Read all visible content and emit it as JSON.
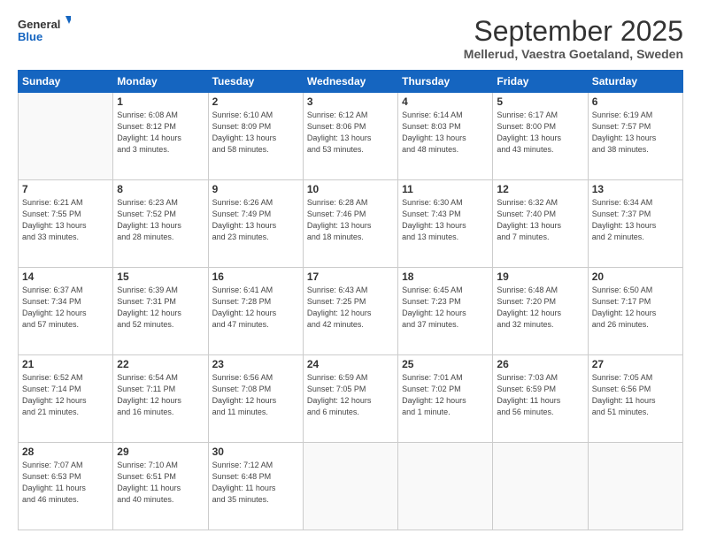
{
  "logo": {
    "general": "General",
    "blue": "Blue"
  },
  "header": {
    "month": "September 2025",
    "location": "Mellerud, Vaestra Goetaland, Sweden"
  },
  "weekdays": [
    "Sunday",
    "Monday",
    "Tuesday",
    "Wednesday",
    "Thursday",
    "Friday",
    "Saturday"
  ],
  "weeks": [
    [
      {
        "day": "",
        "info": ""
      },
      {
        "day": "1",
        "info": "Sunrise: 6:08 AM\nSunset: 8:12 PM\nDaylight: 14 hours\nand 3 minutes."
      },
      {
        "day": "2",
        "info": "Sunrise: 6:10 AM\nSunset: 8:09 PM\nDaylight: 13 hours\nand 58 minutes."
      },
      {
        "day": "3",
        "info": "Sunrise: 6:12 AM\nSunset: 8:06 PM\nDaylight: 13 hours\nand 53 minutes."
      },
      {
        "day": "4",
        "info": "Sunrise: 6:14 AM\nSunset: 8:03 PM\nDaylight: 13 hours\nand 48 minutes."
      },
      {
        "day": "5",
        "info": "Sunrise: 6:17 AM\nSunset: 8:00 PM\nDaylight: 13 hours\nand 43 minutes."
      },
      {
        "day": "6",
        "info": "Sunrise: 6:19 AM\nSunset: 7:57 PM\nDaylight: 13 hours\nand 38 minutes."
      }
    ],
    [
      {
        "day": "7",
        "info": "Sunrise: 6:21 AM\nSunset: 7:55 PM\nDaylight: 13 hours\nand 33 minutes."
      },
      {
        "day": "8",
        "info": "Sunrise: 6:23 AM\nSunset: 7:52 PM\nDaylight: 13 hours\nand 28 minutes."
      },
      {
        "day": "9",
        "info": "Sunrise: 6:26 AM\nSunset: 7:49 PM\nDaylight: 13 hours\nand 23 minutes."
      },
      {
        "day": "10",
        "info": "Sunrise: 6:28 AM\nSunset: 7:46 PM\nDaylight: 13 hours\nand 18 minutes."
      },
      {
        "day": "11",
        "info": "Sunrise: 6:30 AM\nSunset: 7:43 PM\nDaylight: 13 hours\nand 13 minutes."
      },
      {
        "day": "12",
        "info": "Sunrise: 6:32 AM\nSunset: 7:40 PM\nDaylight: 13 hours\nand 7 minutes."
      },
      {
        "day": "13",
        "info": "Sunrise: 6:34 AM\nSunset: 7:37 PM\nDaylight: 13 hours\nand 2 minutes."
      }
    ],
    [
      {
        "day": "14",
        "info": "Sunrise: 6:37 AM\nSunset: 7:34 PM\nDaylight: 12 hours\nand 57 minutes."
      },
      {
        "day": "15",
        "info": "Sunrise: 6:39 AM\nSunset: 7:31 PM\nDaylight: 12 hours\nand 52 minutes."
      },
      {
        "day": "16",
        "info": "Sunrise: 6:41 AM\nSunset: 7:28 PM\nDaylight: 12 hours\nand 47 minutes."
      },
      {
        "day": "17",
        "info": "Sunrise: 6:43 AM\nSunset: 7:25 PM\nDaylight: 12 hours\nand 42 minutes."
      },
      {
        "day": "18",
        "info": "Sunrise: 6:45 AM\nSunset: 7:23 PM\nDaylight: 12 hours\nand 37 minutes."
      },
      {
        "day": "19",
        "info": "Sunrise: 6:48 AM\nSunset: 7:20 PM\nDaylight: 12 hours\nand 32 minutes."
      },
      {
        "day": "20",
        "info": "Sunrise: 6:50 AM\nSunset: 7:17 PM\nDaylight: 12 hours\nand 26 minutes."
      }
    ],
    [
      {
        "day": "21",
        "info": "Sunrise: 6:52 AM\nSunset: 7:14 PM\nDaylight: 12 hours\nand 21 minutes."
      },
      {
        "day": "22",
        "info": "Sunrise: 6:54 AM\nSunset: 7:11 PM\nDaylight: 12 hours\nand 16 minutes."
      },
      {
        "day": "23",
        "info": "Sunrise: 6:56 AM\nSunset: 7:08 PM\nDaylight: 12 hours\nand 11 minutes."
      },
      {
        "day": "24",
        "info": "Sunrise: 6:59 AM\nSunset: 7:05 PM\nDaylight: 12 hours\nand 6 minutes."
      },
      {
        "day": "25",
        "info": "Sunrise: 7:01 AM\nSunset: 7:02 PM\nDaylight: 12 hours\nand 1 minute."
      },
      {
        "day": "26",
        "info": "Sunrise: 7:03 AM\nSunset: 6:59 PM\nDaylight: 11 hours\nand 56 minutes."
      },
      {
        "day": "27",
        "info": "Sunrise: 7:05 AM\nSunset: 6:56 PM\nDaylight: 11 hours\nand 51 minutes."
      }
    ],
    [
      {
        "day": "28",
        "info": "Sunrise: 7:07 AM\nSunset: 6:53 PM\nDaylight: 11 hours\nand 46 minutes."
      },
      {
        "day": "29",
        "info": "Sunrise: 7:10 AM\nSunset: 6:51 PM\nDaylight: 11 hours\nand 40 minutes."
      },
      {
        "day": "30",
        "info": "Sunrise: 7:12 AM\nSunset: 6:48 PM\nDaylight: 11 hours\nand 35 minutes."
      },
      {
        "day": "",
        "info": ""
      },
      {
        "day": "",
        "info": ""
      },
      {
        "day": "",
        "info": ""
      },
      {
        "day": "",
        "info": ""
      }
    ]
  ]
}
